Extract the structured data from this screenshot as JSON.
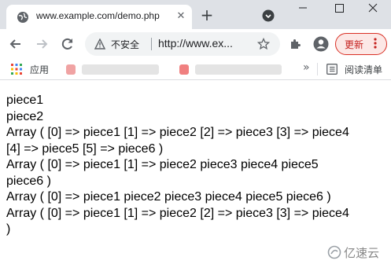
{
  "tab": {
    "title": "www.example.com/demo.php",
    "close_glyph": "✕"
  },
  "newtab_glyph": "+",
  "toolbar": {
    "insecure_label": "不安全",
    "url": "http://www.ex...",
    "update_label": "更新"
  },
  "bookmarks": {
    "apps_label": "应用",
    "more_glyph": "»",
    "reading_list_label": "阅读清单"
  },
  "content": {
    "lines": [
      "piece1",
      "piece2",
      "Array ( [0] => piece1 [1] => piece2 [2] => piece3 [3] => piece4",
      "[4] => piece5 [5] => piece6 )",
      "Array ( [0] => piece1 [1] => piece2 piece3 piece4 piece5",
      "piece6 )",
      "Array ( [0] => piece1 piece2 piece3 piece4 piece5 piece6 )",
      "Array ( [0] => piece1 [1] => piece2 [2] => piece3 [3] => piece4",
      ")"
    ]
  },
  "watermark": {
    "text": "亿速云"
  },
  "colors": {
    "accent_red": "#d93025",
    "tabstrip": "#dee1e6",
    "icon_gray": "#5f6368"
  }
}
